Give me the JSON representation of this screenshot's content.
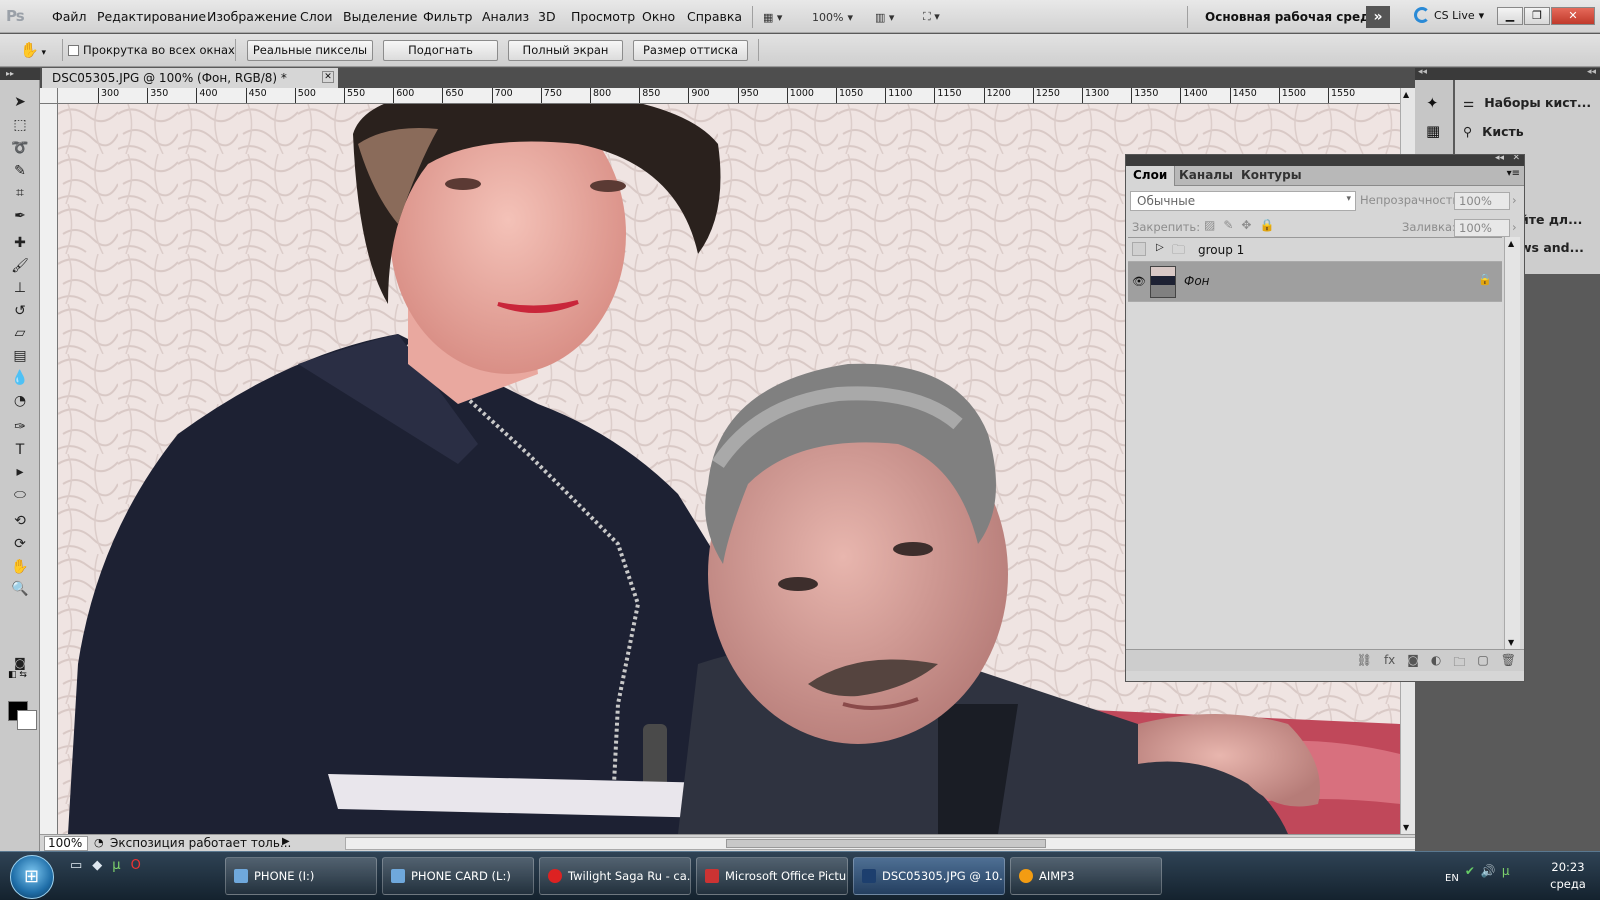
{
  "menubar": {
    "items": [
      "Файл",
      "Редактирование",
      "Изображение",
      "Слои",
      "Выделение",
      "Фильтр",
      "Анализ",
      "3D",
      "Просмотр",
      "Окно",
      "Справка"
    ],
    "zoom": "100%",
    "workspace": "Основная рабочая среда",
    "cs_live": "CS Live"
  },
  "options": {
    "scroll_all_windows": "Прокрутка во всех окнах",
    "actual_pixels": "Реальные пикселы",
    "fit_screen": "Подогнать",
    "full_screen": "Полный экран",
    "print_size": "Размер оттиска"
  },
  "document": {
    "tab_title": "DSC05305.JPG @ 100% (Фон, RGB/8) *"
  },
  "ruler": {
    "ticks": [
      "300",
      "350",
      "400",
      "450",
      "500",
      "550",
      "600",
      "650",
      "700",
      "750",
      "800",
      "850",
      "900",
      "950",
      "1000",
      "1050",
      "1100",
      "1150",
      "1200",
      "1250",
      "1300",
      "1350",
      "1400",
      "1450",
      "1500",
      "1550"
    ]
  },
  "status": {
    "zoom": "100%",
    "text": "Экспозиция работает толь..."
  },
  "brush_panel": {
    "brush_presets": "Наборы кист...",
    "brush": "Кисть"
  },
  "hidden_panel": {
    "line1": "йте дл...",
    "line2": "ws and..."
  },
  "layers_panel": {
    "tabs": [
      "Слои",
      "Каналы",
      "Контуры"
    ],
    "blend_mode": "Обычные",
    "opacity_label": "Непрозрачность:",
    "opacity": "100%",
    "lock_label": "Закрепить:",
    "fill_label": "Заливка:",
    "fill": "100%",
    "layers": [
      {
        "name": "group 1",
        "type": "group",
        "visible": false
      },
      {
        "name": "Фон",
        "type": "background",
        "visible": true,
        "locked": true
      }
    ]
  },
  "taskbar": {
    "buttons": [
      "PHONE (I:)",
      "PHONE CARD (L:)",
      "Twilight Saga Ru - ca...",
      "Microsoft Office Pictu...",
      "DSC05305.JPG @ 10...",
      "AIMP3"
    ],
    "active": "DSC05305.JPG @ 10...",
    "lang": "EN",
    "time": "20:23",
    "day": "среда"
  }
}
